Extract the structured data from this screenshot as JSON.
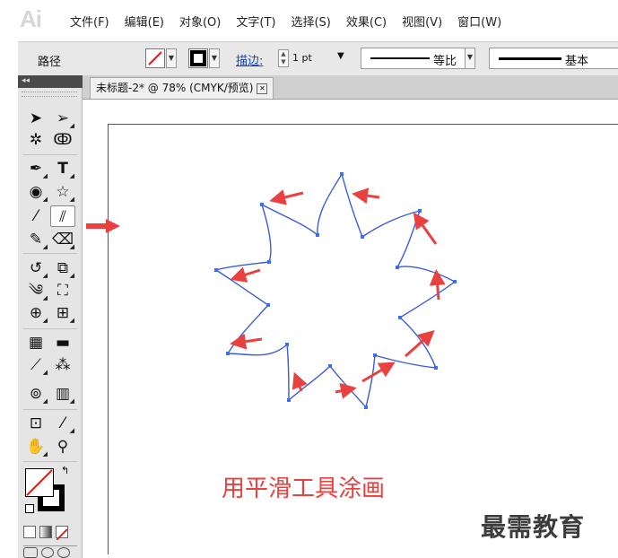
{
  "app": {
    "logo": "Ai"
  },
  "menu": [
    "文件(F)",
    "编辑(E)",
    "对象(O)",
    "文字(T)",
    "选择(S)",
    "效果(C)",
    "视图(V)",
    "窗口(W)"
  ],
  "control_bar": {
    "object_label": "路径",
    "stroke_link": "描边:",
    "stroke_weight": "1 pt",
    "profile_uniform": "等比",
    "brush_basic": "基本"
  },
  "document": {
    "tab_title": "未标题-2* @ 78% (CMYK/预览)"
  },
  "tools": [
    "selection-tool",
    "direct-selection-tool",
    "magic-wand-tool",
    "lasso-tool",
    "pen-tool",
    "type-tool",
    "polar-grid-tool",
    "star-tool",
    "paintbrush-tool",
    "smooth-tool",
    "pencil-tool",
    "eraser-tool",
    "rotate-tool",
    "scale-tool",
    "warp-tool",
    "free-transform-tool",
    "shape-builder-tool",
    "perspective-grid-tool",
    "mesh-tool",
    "gradient-tool",
    "eyedropper-tool",
    "blend-tool",
    "symbol-sprayer-tool",
    "column-graph-tool",
    "artboard-tool",
    "slice-tool",
    "hand-tool",
    "zoom-tool"
  ],
  "active_tool": "smooth-tool",
  "colors": {
    "annotation_red": "#e8413f",
    "path_blue": "#3b5bd6",
    "anchor_blue": "#3b6ef0"
  },
  "caption": "用平滑工具涂画",
  "watermark": "最需教育"
}
